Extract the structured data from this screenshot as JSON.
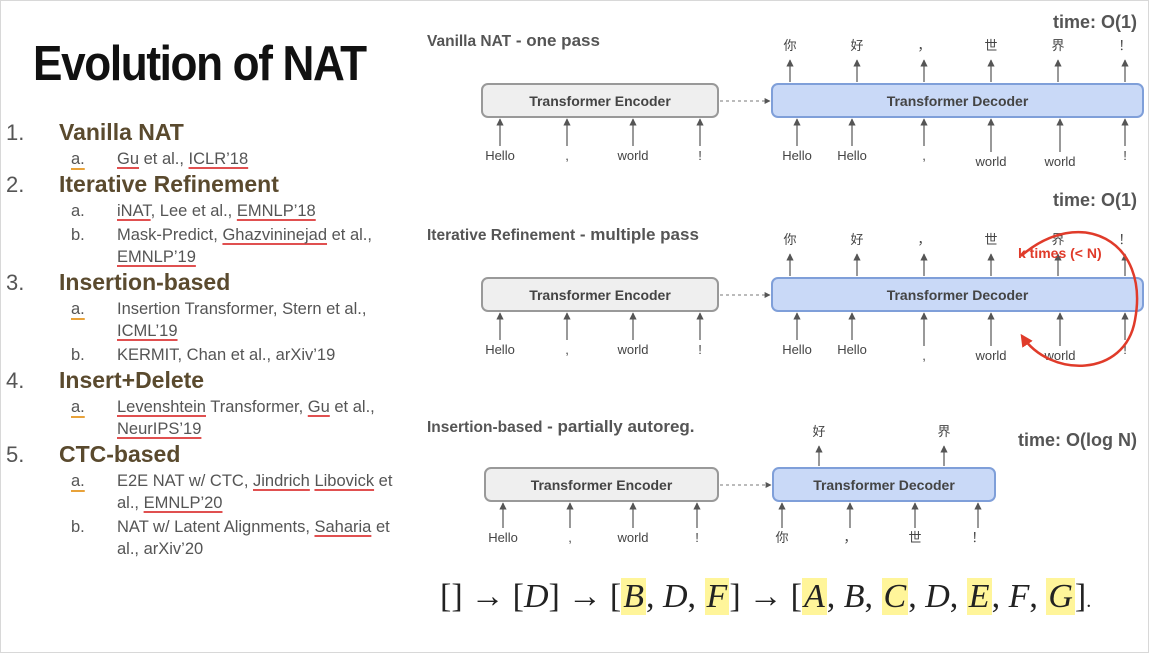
{
  "slide": {
    "title": "Evolution of NAT",
    "outline": [
      {
        "num": "1.",
        "label": "Vanilla NAT",
        "subs": [
          {
            "letter": "a.",
            "text": "Gu et al., ICLR’18"
          }
        ]
      },
      {
        "num": "2.",
        "label": "Iterative Refinement",
        "subs": [
          {
            "letter": "a.",
            "text": "iNAT, Lee et al., EMNLP’18"
          },
          {
            "letter": "b.",
            "text": "Mask-Predict, Ghazvininejad et al., EMNLP’19"
          }
        ]
      },
      {
        "num": "3.",
        "label": "Insertion-based",
        "subs": [
          {
            "letter": "a.",
            "text": "Insertion Transformer, Stern et al., ICML’19"
          },
          {
            "letter": "b.",
            "text": "KERMIT, Chan et al., arXiv’19"
          }
        ]
      },
      {
        "num": "4.",
        "label": "Insert+Delete",
        "subs": [
          {
            "letter": "a.",
            "text": "Levenshtein Transformer, Gu et al., NeurIPS’19"
          }
        ]
      },
      {
        "num": "5.",
        "label": "CTC-based",
        "subs": [
          {
            "letter": "a.",
            "text": "E2E NAT w/ CTC, Jindrich Libovick et al., EMNLP’20"
          },
          {
            "letter": "b.",
            "text": "NAT w/ Latent Alignments, Saharia et al., arXiv’20"
          }
        ]
      }
    ]
  },
  "diagrams": {
    "vanilla": {
      "header_bold": "Vanilla NAT",
      "header_rest": " - one pass",
      "time": "time: O(1)",
      "encoder": "Transformer Encoder",
      "decoder": "Transformer Decoder",
      "enc_inputs": [
        "Hello",
        ",",
        "world",
        "!"
      ],
      "dec_inputs": [
        "Hello",
        "Hello",
        ",",
        "world",
        "world",
        "!"
      ],
      "outputs": [
        "你",
        "好",
        "，",
        "世",
        "界",
        "！"
      ]
    },
    "iterative": {
      "header_bold": "Iterative Refinement",
      "header_rest": " - multiple pass",
      "time": "time: O(1)",
      "loop_label": "k times (< N)",
      "encoder": "Transformer Encoder",
      "decoder": "Transformer Decoder",
      "enc_inputs": [
        "Hello",
        ",",
        "world",
        "!"
      ],
      "dec_inputs": [
        "Hello",
        "Hello",
        ",",
        "world",
        "world",
        "!"
      ],
      "outputs": [
        "你",
        "好",
        "，",
        "世",
        "界",
        "！"
      ]
    },
    "insertion": {
      "header_bold": "Insertion-based",
      "header_rest": " - partially autoreg.",
      "time": "time: O(log N)",
      "encoder": "Transformer Encoder",
      "decoder": "Transformer Decoder",
      "enc_inputs": [
        "Hello",
        ",",
        "world",
        "!"
      ],
      "dec_inputs": [
        "你",
        "，",
        "世",
        "！"
      ],
      "outputs": [
        "好",
        "界"
      ]
    }
  },
  "sequence": {
    "steps": [
      {
        "tokens": []
      },
      {
        "tokens": [
          {
            "t": "D",
            "h": false
          }
        ]
      },
      {
        "tokens": [
          {
            "t": "B",
            "h": true
          },
          {
            "t": "D",
            "h": false
          },
          {
            "t": "F",
            "h": true
          }
        ]
      },
      {
        "tokens": [
          {
            "t": "A",
            "h": true
          },
          {
            "t": "B",
            "h": false
          },
          {
            "t": "C",
            "h": true
          },
          {
            "t": "D",
            "h": false
          },
          {
            "t": "E",
            "h": true
          },
          {
            "t": "F",
            "h": false
          },
          {
            "t": "G",
            "h": true
          }
        ]
      }
    ],
    "arrow": "→",
    "trailing": "."
  },
  "colors": {
    "encoder_fill": "#efefef",
    "encoder_stroke": "#999999",
    "decoder_fill": "#c9d9f7",
    "decoder_stroke": "#7f9fd9",
    "loop": "#e03b2a",
    "highlight": "#fff59a"
  }
}
